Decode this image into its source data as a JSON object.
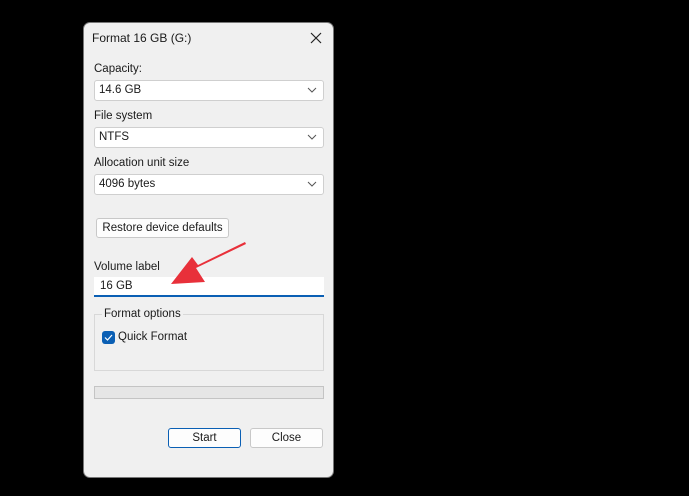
{
  "dialog": {
    "title": "Format 16 GB (G:)",
    "capacity": {
      "label": "Capacity:",
      "value": "14.6 GB"
    },
    "file_system": {
      "label": "File system",
      "value": "NTFS"
    },
    "allocation": {
      "label": "Allocation unit size",
      "value": "4096 bytes"
    },
    "restore_label": "Restore device defaults",
    "volume": {
      "label": "Volume label",
      "value": "16 GB"
    },
    "format_options": {
      "label": "Format options",
      "quick_format": "Quick Format",
      "quick_format_checked": true
    },
    "progress": 0,
    "start_label": "Start",
    "close_label": "Close"
  },
  "colors": {
    "accent": "#0a5fb4",
    "annotation_arrow": "#e8303a"
  }
}
